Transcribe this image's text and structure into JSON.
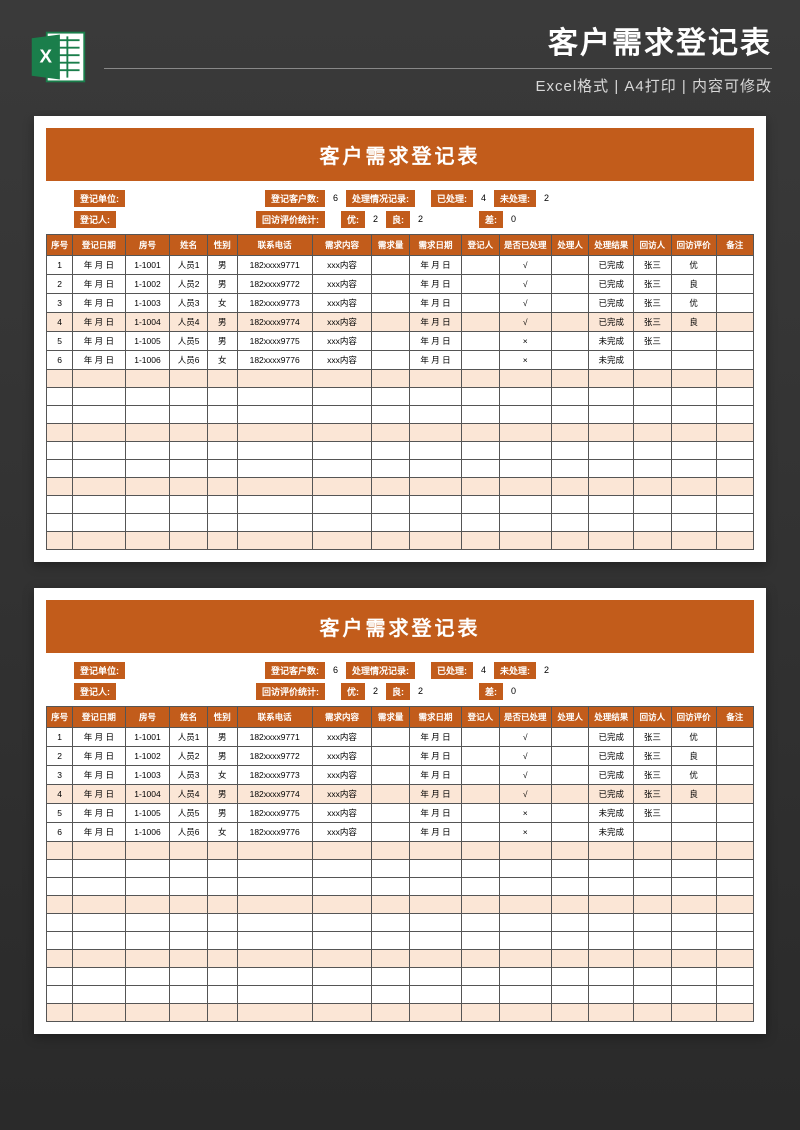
{
  "header": {
    "main_title": "客户需求登记表",
    "sub_title": "Excel格式 | A4打印 | 内容可修改"
  },
  "sheet": {
    "title": "客户需求登记表",
    "summary": {
      "row1": {
        "unit_label": "登记单位:",
        "unit_value": "",
        "count_label": "登记客户数:",
        "count_value": "6",
        "record_label": "处理情况记录:",
        "processed_label": "已处理:",
        "processed_value": "4",
        "unprocessed_label": "未处理:",
        "unprocessed_value": "2"
      },
      "row2": {
        "registrar_label": "登记人:",
        "registrar_value": "",
        "stat_label": "回访评价统计:",
        "excellent_label": "优:",
        "excellent_value": "2",
        "good_label": "良:",
        "good_value": "2",
        "bad_label": "差:",
        "bad_value": "0"
      }
    },
    "columns": [
      "序号",
      "登记日期",
      "房号",
      "姓名",
      "性别",
      "联系电话",
      "需求内容",
      "需求量",
      "需求日期",
      "登记人",
      "是否已处理",
      "处理人",
      "处理结果",
      "回访人",
      "回访评价",
      "备注"
    ],
    "rows": [
      {
        "seq": "1",
        "date": "年 月 日",
        "room": "1-1001",
        "name": "人员1",
        "sex": "男",
        "tel": "182xxxx9771",
        "content": "xxx内容",
        "qty": "",
        "rdate": "年 月 日",
        "reg": "",
        "proc": "√",
        "hand": "",
        "res": "已完成",
        "vis": "张三",
        "eval": "优",
        "note": ""
      },
      {
        "seq": "2",
        "date": "年 月 日",
        "room": "1-1002",
        "name": "人员2",
        "sex": "男",
        "tel": "182xxxx9772",
        "content": "xxx内容",
        "qty": "",
        "rdate": "年 月 日",
        "reg": "",
        "proc": "√",
        "hand": "",
        "res": "已完成",
        "vis": "张三",
        "eval": "良",
        "note": ""
      },
      {
        "seq": "3",
        "date": "年 月 日",
        "room": "1-1003",
        "name": "人员3",
        "sex": "女",
        "tel": "182xxxx9773",
        "content": "xxx内容",
        "qty": "",
        "rdate": "年 月 日",
        "reg": "",
        "proc": "√",
        "hand": "",
        "res": "已完成",
        "vis": "张三",
        "eval": "优",
        "note": ""
      },
      {
        "seq": "4",
        "date": "年 月 日",
        "room": "1-1004",
        "name": "人员4",
        "sex": "男",
        "tel": "182xxxx9774",
        "content": "xxx内容",
        "qty": "",
        "rdate": "年 月 日",
        "reg": "",
        "proc": "√",
        "hand": "",
        "res": "已完成",
        "vis": "张三",
        "eval": "良",
        "note": ""
      },
      {
        "seq": "5",
        "date": "年 月 日",
        "room": "1-1005",
        "name": "人员5",
        "sex": "男",
        "tel": "182xxxx9775",
        "content": "xxx内容",
        "qty": "",
        "rdate": "年 月 日",
        "reg": "",
        "proc": "×",
        "hand": "",
        "res": "未完成",
        "vis": "张三",
        "eval": "",
        "note": ""
      },
      {
        "seq": "6",
        "date": "年 月 日",
        "room": "1-1006",
        "name": "人员6",
        "sex": "女",
        "tel": "182xxxx9776",
        "content": "xxx内容",
        "qty": "",
        "rdate": "年 月 日",
        "reg": "",
        "proc": "×",
        "hand": "",
        "res": "未完成",
        "vis": "",
        "eval": "",
        "note": ""
      }
    ],
    "empty_rows": 10,
    "alt_rows": [
      3,
      6,
      9,
      12,
      15
    ]
  }
}
